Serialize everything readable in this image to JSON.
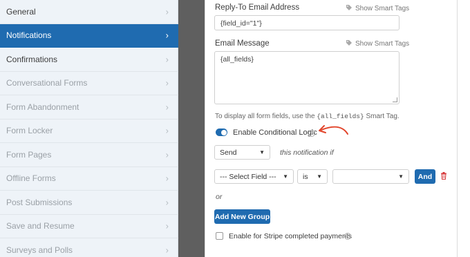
{
  "sidebar": {
    "items": [
      {
        "label": "General",
        "state": "normal"
      },
      {
        "label": "Notifications",
        "state": "active"
      },
      {
        "label": "Confirmations",
        "state": "normal"
      },
      {
        "label": "Conversational Forms",
        "state": "disabled"
      },
      {
        "label": "Form Abandonment",
        "state": "disabled"
      },
      {
        "label": "Form Locker",
        "state": "disabled"
      },
      {
        "label": "Form Pages",
        "state": "disabled"
      },
      {
        "label": "Offline Forms",
        "state": "disabled"
      },
      {
        "label": "Post Submissions",
        "state": "disabled"
      },
      {
        "label": "Save and Resume",
        "state": "disabled"
      },
      {
        "label": "Surveys and Polls",
        "state": "disabled"
      }
    ],
    "chevron": "›"
  },
  "notification": {
    "reply_to_label": "Reply-To Email Address",
    "smart_tags_label": "Show Smart Tags",
    "reply_to_value": "{field_id=\"1\"}",
    "email_message_label": "Email Message",
    "email_message_value": "{all_fields}",
    "hint_prefix": "To display all form fields, use the",
    "hint_code": "{all_fields}",
    "hint_suffix": "Smart Tag.",
    "conditional_logic_label": "Enable Conditional Logic",
    "conditional_logic_enabled": true,
    "help_glyph": "?",
    "action_select_value": "Send",
    "action_suffix": "this notification if",
    "field_select_value": "--- Select Field ---",
    "operator_select_value": "is",
    "value_select_value": "",
    "and_button": "And",
    "or_label": "or",
    "add_group_button": "Add New Group",
    "stripe_label": "Enable for Stripe completed payments"
  },
  "colors": {
    "accent": "#1f6bb0",
    "annotation_arrow": "#e2452b",
    "trash": "#d63638"
  },
  "icons": {
    "tag": "tag-icon",
    "help": "help-circle-icon",
    "trash": "trash-icon",
    "arrow": "annotation-arrow"
  }
}
